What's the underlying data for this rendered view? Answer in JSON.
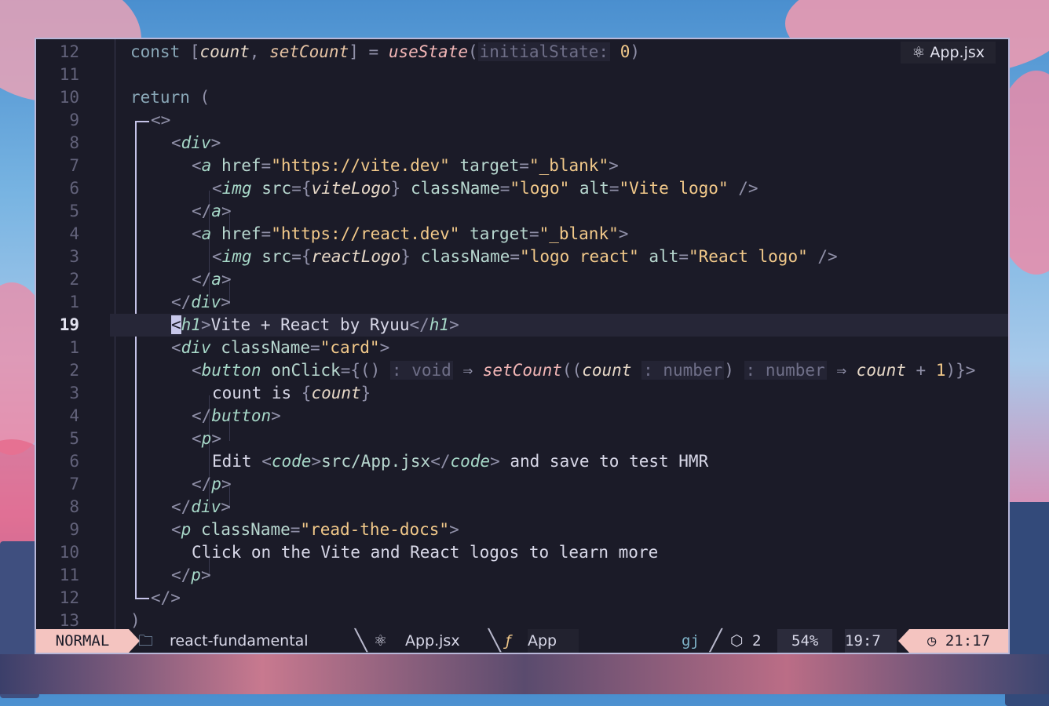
{
  "editor": {
    "file_badge": "App.jsx",
    "gutter": [
      "12",
      "11",
      "10",
      "9",
      "8",
      "7",
      "6",
      "5",
      "4",
      "3",
      "2",
      "1",
      "19",
      "1",
      "2",
      "3",
      "4",
      "5",
      "6",
      "7",
      "8",
      "9",
      "10",
      "11",
      "12",
      "13"
    ],
    "current_line_index": 12
  },
  "statusbar": {
    "mode": "NORMAL",
    "project": "react-fundamental",
    "file": "App.jsx",
    "symbol": "App",
    "branch_hint": "gj",
    "lsp_count": "2",
    "percent": "54%",
    "position": "19:7",
    "time": "21:17"
  },
  "colors": {
    "editor_bg": "#1b1b28",
    "current_line_bg": "#262637",
    "mode_bg": "#f4c4c0",
    "string": "#f2c98a",
    "tag": "#a7d8c8"
  }
}
